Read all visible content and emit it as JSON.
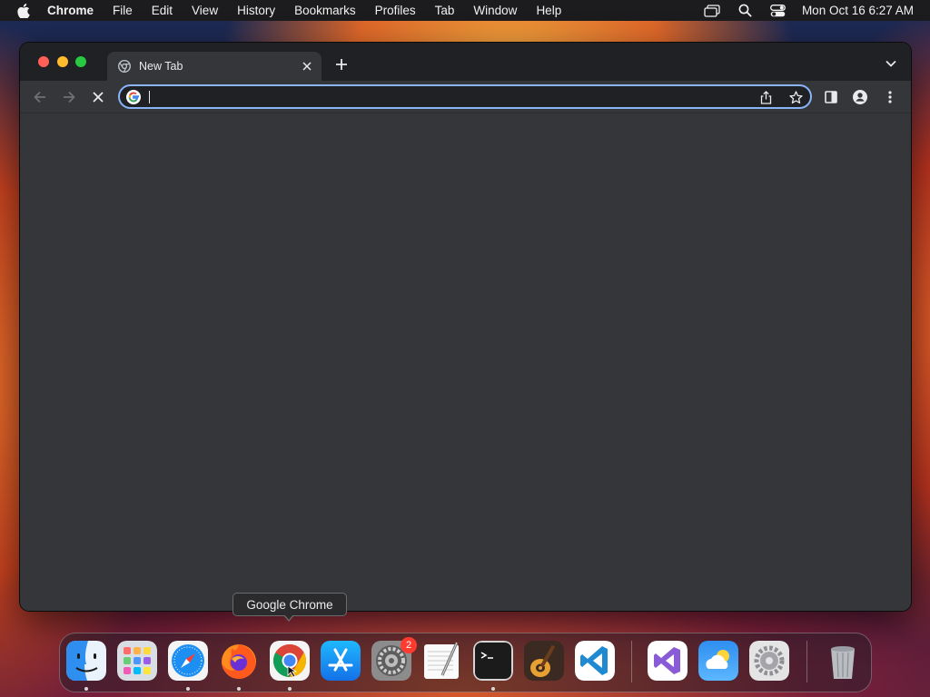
{
  "menubar": {
    "app_name": "Chrome",
    "items": [
      "File",
      "Edit",
      "View",
      "History",
      "Bookmarks",
      "Profiles",
      "Tab",
      "Window",
      "Help"
    ],
    "clock": "Mon Oct 16  6:27 AM",
    "status_icons": [
      "screen-mirroring-icon",
      "spotlight-search-icon",
      "control-center-icon"
    ]
  },
  "browser": {
    "tab": {
      "title": "New Tab",
      "favicon": "chrome-newtab-icon"
    },
    "omnibox": {
      "value": "",
      "placeholder": ""
    },
    "toolbar_icons": [
      "back-arrow-icon",
      "forward-arrow-icon",
      "stop-loading-icon",
      "share-icon",
      "bookmark-star-icon",
      "side-panel-icon",
      "profile-icon",
      "menu-kebab-icon"
    ]
  },
  "tooltip": {
    "text": "Google Chrome"
  },
  "dock": {
    "apps": [
      {
        "name": "Finder",
        "running": true
      },
      {
        "name": "Launchpad",
        "running": false
      },
      {
        "name": "Safari",
        "running": true
      },
      {
        "name": "Firefox",
        "running": true
      },
      {
        "name": "Google Chrome",
        "running": true
      },
      {
        "name": "App Store",
        "running": false
      },
      {
        "name": "System Preferences",
        "running": false,
        "badge": "2"
      },
      {
        "name": "TextEdit",
        "running": false
      },
      {
        "name": "Terminal",
        "running": true
      },
      {
        "name": "GarageBand",
        "running": false
      },
      {
        "name": "Visual Studio Code",
        "running": false
      },
      {
        "name": "Visual Studio",
        "running": false
      },
      {
        "name": "Weather",
        "running": false
      },
      {
        "name": "System Settings",
        "running": false
      },
      {
        "name": "Trash",
        "running": false
      }
    ]
  },
  "colors": {
    "menubar_bg": "#1c1c1e",
    "tabstrip_bg": "#202124",
    "toolbar_bg": "#35363a",
    "omnibox_focus": "#8ab4f8",
    "badge_red": "#ff3b30"
  }
}
